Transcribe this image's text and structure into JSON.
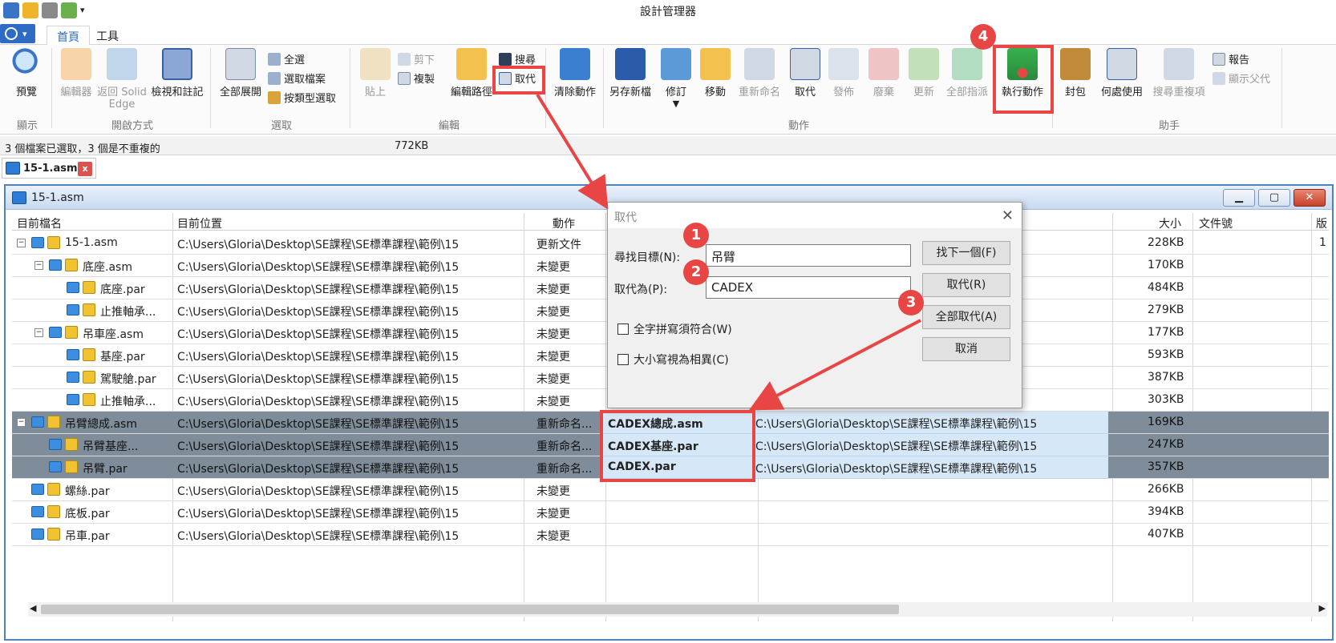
{
  "window": {
    "title": "設計管理器"
  },
  "ribbon_tabs": [
    "首頁",
    "工具"
  ],
  "ribbon": {
    "preview": "預覽",
    "editor": "編輯器",
    "return_solid_edge_1": "返回 Solid",
    "return_solid_edge_2": "Edge",
    "view_markup": "檢視和註記",
    "expand_all": "全部展開",
    "select_all": "全選",
    "select_file": "選取檔案",
    "select_by_type": "按類型選取",
    "paste": "貼上",
    "cut": "剪下",
    "copy": "複製",
    "edit_path": "編輯路徑",
    "search": "搜尋",
    "replace": "取代",
    "clear_action": "清除動作",
    "save_new": "另存新檔",
    "revise": "修訂",
    "move": "移動",
    "rename": "重新命名",
    "replace2": "取代",
    "publish": "發佈",
    "obsolete": "廢棄",
    "update": "更新",
    "all_specify": "全部指派",
    "perform": "執行動作",
    "pack": "封包",
    "where_used": "何處使用",
    "search_dup": "搜尋重複項",
    "report": "報告",
    "show_parent": "顯示父代"
  },
  "groups": {
    "display": "顯示",
    "open_mode": "開啟方式",
    "select": "選取",
    "edit": "編輯",
    "action": "動作",
    "helper": "助手"
  },
  "status": {
    "selection": "3 個檔案已選取，3 個是不重複的",
    "size": "772KB"
  },
  "doc_tab": {
    "name": "15-1.asm",
    "close": "x"
  },
  "mdi": {
    "title": "15-1.asm"
  },
  "columns": {
    "name": "目前檔名",
    "location": "目前位置",
    "action": "動作",
    "size": "大小",
    "docno": "文件號",
    "rev": "版"
  },
  "rows": [
    {
      "name": "15-1.asm",
      "loc": "C:\\Users\\Gloria\\Desktop\\SE課程\\SE標準課程\\範例\\15",
      "action": "更新文件",
      "size": "228KB",
      "rev": "1"
    },
    {
      "name": "底座.asm",
      "loc": "C:\\Users\\Gloria\\Desktop\\SE課程\\SE標準課程\\範例\\15",
      "action": "未變更",
      "size": "170KB"
    },
    {
      "name": "底座.par",
      "loc": "C:\\Users\\Gloria\\Desktop\\SE課程\\SE標準課程\\範例\\15",
      "action": "未變更",
      "size": "484KB"
    },
    {
      "name": "止推軸承...",
      "loc": "C:\\Users\\Gloria\\Desktop\\SE課程\\SE標準課程\\範例\\15",
      "action": "未變更",
      "size": "279KB"
    },
    {
      "name": "吊車座.asm",
      "loc": "C:\\Users\\Gloria\\Desktop\\SE課程\\SE標準課程\\範例\\15",
      "action": "未變更",
      "size": "177KB"
    },
    {
      "name": "基座.par",
      "loc": "C:\\Users\\Gloria\\Desktop\\SE課程\\SE標準課程\\範例\\15",
      "action": "未變更",
      "size": "593KB"
    },
    {
      "name": "駕駛艙.par",
      "loc": "C:\\Users\\Gloria\\Desktop\\SE課程\\SE標準課程\\範例\\15",
      "action": "未變更",
      "size": "387KB"
    },
    {
      "name": "止推軸承...",
      "loc": "C:\\Users\\Gloria\\Desktop\\SE課程\\SE標準課程\\範例\\15",
      "action": "未變更",
      "size": "303KB"
    },
    {
      "name": "吊臂總成.asm",
      "loc": "C:\\Users\\Gloria\\Desktop\\SE課程\\SE標準課程\\範例\\15",
      "action": "重新命名...",
      "size": "169KB"
    },
    {
      "name": "吊臂基座...",
      "loc": "C:\\Users\\Gloria\\Desktop\\SE課程\\SE標準課程\\範例\\15",
      "action": "重新命名...",
      "size": "247KB"
    },
    {
      "name": "吊臂.par",
      "loc": "C:\\Users\\Gloria\\Desktop\\SE課程\\SE標準課程\\範例\\15",
      "action": "重新命名...",
      "size": "357KB"
    },
    {
      "name": "螺絲.par",
      "loc": "C:\\Users\\Gloria\\Desktop\\SE課程\\SE標準課程\\範例\\15",
      "action": "未變更",
      "size": "266KB"
    },
    {
      "name": "底板.par",
      "loc": "C:\\Users\\Gloria\\Desktop\\SE課程\\SE標準課程\\範例\\15",
      "action": "未變更",
      "size": "394KB"
    },
    {
      "name": "吊車.par",
      "loc": "C:\\Users\\Gloria\\Desktop\\SE課程\\SE標準課程\\範例\\15",
      "action": "未變更",
      "size": "407KB"
    }
  ],
  "new_names": [
    {
      "name": "CADEX總成.asm",
      "loc": "C:\\Users\\Gloria\\Desktop\\SE課程\\SE標準課程\\範例\\15"
    },
    {
      "name": "CADEX基座.par",
      "loc": "C:\\Users\\Gloria\\Desktop\\SE課程\\SE標準課程\\範例\\15"
    },
    {
      "name": "CADEX.par",
      "loc": "C:\\Users\\Gloria\\Desktop\\SE課程\\SE標準課程\\範例\\15"
    }
  ],
  "dialog": {
    "title": "取代",
    "find_label": "尋找目標(N):",
    "find_value": "吊臂",
    "replace_label": "取代為(P):",
    "replace_value": "CADEX",
    "whole_word": "全字拼寫須符合(W)",
    "match_case": "大小寫視為相異(C)",
    "find_next": "找下一個(F)",
    "replace": "取代(R)",
    "replace_all": "全部取代(A)",
    "cancel": "取消"
  },
  "badges": [
    "1",
    "2",
    "3",
    "4"
  ],
  "colors": {
    "accent": "#2e6bc4",
    "annotation": "#e84545",
    "selection": "#7f8c99",
    "new_name_bg": "#d6e8f7"
  }
}
